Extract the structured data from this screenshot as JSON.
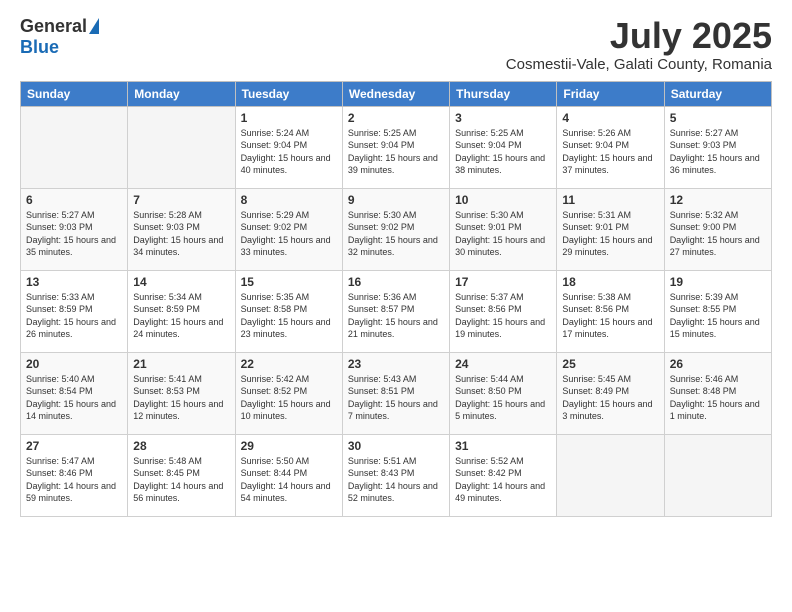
{
  "logo": {
    "general": "General",
    "blue": "Blue"
  },
  "header": {
    "month": "July 2025",
    "location": "Cosmestii-Vale, Galati County, Romania"
  },
  "days_of_week": [
    "Sunday",
    "Monday",
    "Tuesday",
    "Wednesday",
    "Thursday",
    "Friday",
    "Saturday"
  ],
  "weeks": [
    [
      {
        "day": "",
        "empty": true
      },
      {
        "day": "",
        "empty": true
      },
      {
        "day": "1",
        "sunrise": "Sunrise: 5:24 AM",
        "sunset": "Sunset: 9:04 PM",
        "daylight": "Daylight: 15 hours and 40 minutes."
      },
      {
        "day": "2",
        "sunrise": "Sunrise: 5:25 AM",
        "sunset": "Sunset: 9:04 PM",
        "daylight": "Daylight: 15 hours and 39 minutes."
      },
      {
        "day": "3",
        "sunrise": "Sunrise: 5:25 AM",
        "sunset": "Sunset: 9:04 PM",
        "daylight": "Daylight: 15 hours and 38 minutes."
      },
      {
        "day": "4",
        "sunrise": "Sunrise: 5:26 AM",
        "sunset": "Sunset: 9:04 PM",
        "daylight": "Daylight: 15 hours and 37 minutes."
      },
      {
        "day": "5",
        "sunrise": "Sunrise: 5:27 AM",
        "sunset": "Sunset: 9:03 PM",
        "daylight": "Daylight: 15 hours and 36 minutes."
      }
    ],
    [
      {
        "day": "6",
        "sunrise": "Sunrise: 5:27 AM",
        "sunset": "Sunset: 9:03 PM",
        "daylight": "Daylight: 15 hours and 35 minutes."
      },
      {
        "day": "7",
        "sunrise": "Sunrise: 5:28 AM",
        "sunset": "Sunset: 9:03 PM",
        "daylight": "Daylight: 15 hours and 34 minutes."
      },
      {
        "day": "8",
        "sunrise": "Sunrise: 5:29 AM",
        "sunset": "Sunset: 9:02 PM",
        "daylight": "Daylight: 15 hours and 33 minutes."
      },
      {
        "day": "9",
        "sunrise": "Sunrise: 5:30 AM",
        "sunset": "Sunset: 9:02 PM",
        "daylight": "Daylight: 15 hours and 32 minutes."
      },
      {
        "day": "10",
        "sunrise": "Sunrise: 5:30 AM",
        "sunset": "Sunset: 9:01 PM",
        "daylight": "Daylight: 15 hours and 30 minutes."
      },
      {
        "day": "11",
        "sunrise": "Sunrise: 5:31 AM",
        "sunset": "Sunset: 9:01 PM",
        "daylight": "Daylight: 15 hours and 29 minutes."
      },
      {
        "day": "12",
        "sunrise": "Sunrise: 5:32 AM",
        "sunset": "Sunset: 9:00 PM",
        "daylight": "Daylight: 15 hours and 27 minutes."
      }
    ],
    [
      {
        "day": "13",
        "sunrise": "Sunrise: 5:33 AM",
        "sunset": "Sunset: 8:59 PM",
        "daylight": "Daylight: 15 hours and 26 minutes."
      },
      {
        "day": "14",
        "sunrise": "Sunrise: 5:34 AM",
        "sunset": "Sunset: 8:59 PM",
        "daylight": "Daylight: 15 hours and 24 minutes."
      },
      {
        "day": "15",
        "sunrise": "Sunrise: 5:35 AM",
        "sunset": "Sunset: 8:58 PM",
        "daylight": "Daylight: 15 hours and 23 minutes."
      },
      {
        "day": "16",
        "sunrise": "Sunrise: 5:36 AM",
        "sunset": "Sunset: 8:57 PM",
        "daylight": "Daylight: 15 hours and 21 minutes."
      },
      {
        "day": "17",
        "sunrise": "Sunrise: 5:37 AM",
        "sunset": "Sunset: 8:56 PM",
        "daylight": "Daylight: 15 hours and 19 minutes."
      },
      {
        "day": "18",
        "sunrise": "Sunrise: 5:38 AM",
        "sunset": "Sunset: 8:56 PM",
        "daylight": "Daylight: 15 hours and 17 minutes."
      },
      {
        "day": "19",
        "sunrise": "Sunrise: 5:39 AM",
        "sunset": "Sunset: 8:55 PM",
        "daylight": "Daylight: 15 hours and 15 minutes."
      }
    ],
    [
      {
        "day": "20",
        "sunrise": "Sunrise: 5:40 AM",
        "sunset": "Sunset: 8:54 PM",
        "daylight": "Daylight: 15 hours and 14 minutes."
      },
      {
        "day": "21",
        "sunrise": "Sunrise: 5:41 AM",
        "sunset": "Sunset: 8:53 PM",
        "daylight": "Daylight: 15 hours and 12 minutes."
      },
      {
        "day": "22",
        "sunrise": "Sunrise: 5:42 AM",
        "sunset": "Sunset: 8:52 PM",
        "daylight": "Daylight: 15 hours and 10 minutes."
      },
      {
        "day": "23",
        "sunrise": "Sunrise: 5:43 AM",
        "sunset": "Sunset: 8:51 PM",
        "daylight": "Daylight: 15 hours and 7 minutes."
      },
      {
        "day": "24",
        "sunrise": "Sunrise: 5:44 AM",
        "sunset": "Sunset: 8:50 PM",
        "daylight": "Daylight: 15 hours and 5 minutes."
      },
      {
        "day": "25",
        "sunrise": "Sunrise: 5:45 AM",
        "sunset": "Sunset: 8:49 PM",
        "daylight": "Daylight: 15 hours and 3 minutes."
      },
      {
        "day": "26",
        "sunrise": "Sunrise: 5:46 AM",
        "sunset": "Sunset: 8:48 PM",
        "daylight": "Daylight: 15 hours and 1 minute."
      }
    ],
    [
      {
        "day": "27",
        "sunrise": "Sunrise: 5:47 AM",
        "sunset": "Sunset: 8:46 PM",
        "daylight": "Daylight: 14 hours and 59 minutes."
      },
      {
        "day": "28",
        "sunrise": "Sunrise: 5:48 AM",
        "sunset": "Sunset: 8:45 PM",
        "daylight": "Daylight: 14 hours and 56 minutes."
      },
      {
        "day": "29",
        "sunrise": "Sunrise: 5:50 AM",
        "sunset": "Sunset: 8:44 PM",
        "daylight": "Daylight: 14 hours and 54 minutes."
      },
      {
        "day": "30",
        "sunrise": "Sunrise: 5:51 AM",
        "sunset": "Sunset: 8:43 PM",
        "daylight": "Daylight: 14 hours and 52 minutes."
      },
      {
        "day": "31",
        "sunrise": "Sunrise: 5:52 AM",
        "sunset": "Sunset: 8:42 PM",
        "daylight": "Daylight: 14 hours and 49 minutes."
      },
      {
        "day": "",
        "empty": true
      },
      {
        "day": "",
        "empty": true
      }
    ]
  ]
}
